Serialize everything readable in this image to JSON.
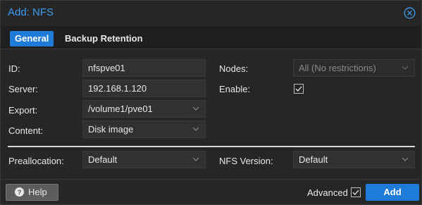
{
  "dialog": {
    "title": "Add: NFS",
    "close_icon": "close-circle-icon"
  },
  "tabs": [
    {
      "label": "General",
      "active": true
    },
    {
      "label": "Backup Retention",
      "active": false
    }
  ],
  "form": {
    "id": {
      "label": "ID:",
      "value": "nfspve01"
    },
    "server": {
      "label": "Server:",
      "value": "192.168.1.120"
    },
    "export": {
      "label": "Export:",
      "value": "/volume1/pve01"
    },
    "content": {
      "label": "Content:",
      "value": "Disk image"
    },
    "nodes": {
      "label": "Nodes:",
      "value": "All (No restrictions)",
      "disabled": true
    },
    "enable": {
      "label": "Enable:",
      "checked": true
    },
    "preallocation": {
      "label": "Preallocation:",
      "value": "Default"
    },
    "nfs_version": {
      "label": "NFS Version:",
      "value": "Default"
    }
  },
  "footer": {
    "help_label": "Help",
    "advanced_label": "Advanced",
    "advanced_checked": true,
    "add_label": "Add"
  },
  "colors": {
    "accent": "#1e7bd7",
    "title": "#3c9df0",
    "background": "#262626"
  }
}
